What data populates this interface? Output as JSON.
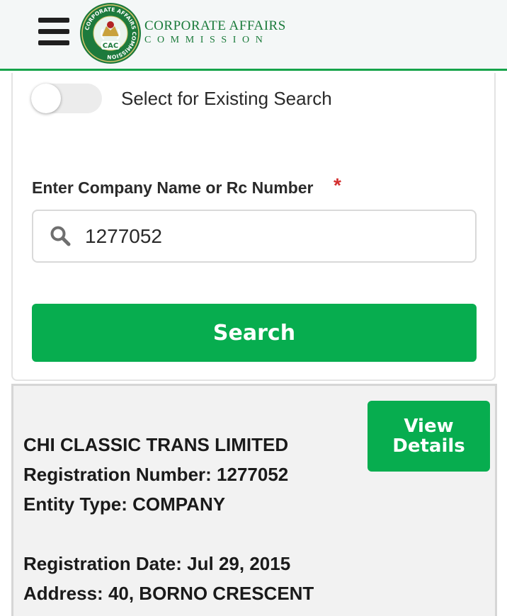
{
  "header": {
    "logo_line1": "CORPORATE AFFAIRS",
    "logo_line2": "COMMISSION",
    "seal_text": "CORPORATE AFFAIRS COMMISSION",
    "seal_abbr": "CAC",
    "accent_color": "#16a34a"
  },
  "form": {
    "toggle_label": "Select for Existing Search",
    "toggle_on": false,
    "field_label": "Enter Company Name or Rc Number",
    "required_mark": "*",
    "search_value": "1277052",
    "search_button_label": "Search",
    "button_color": "#07ad4f"
  },
  "result": {
    "company_name": "CHI CLASSIC TRANS LIMITED",
    "reg_number_label": "Registration Number:",
    "reg_number": "1277052",
    "entity_type_label": "Entity Type:",
    "entity_type": "COMPANY",
    "reg_date_label": "Registration Date:",
    "reg_date": "Jul 29, 2015",
    "address_label": "Address:",
    "address": "40, BORNO CRESCENT",
    "view_line1": "View",
    "view_line2": "Details"
  }
}
